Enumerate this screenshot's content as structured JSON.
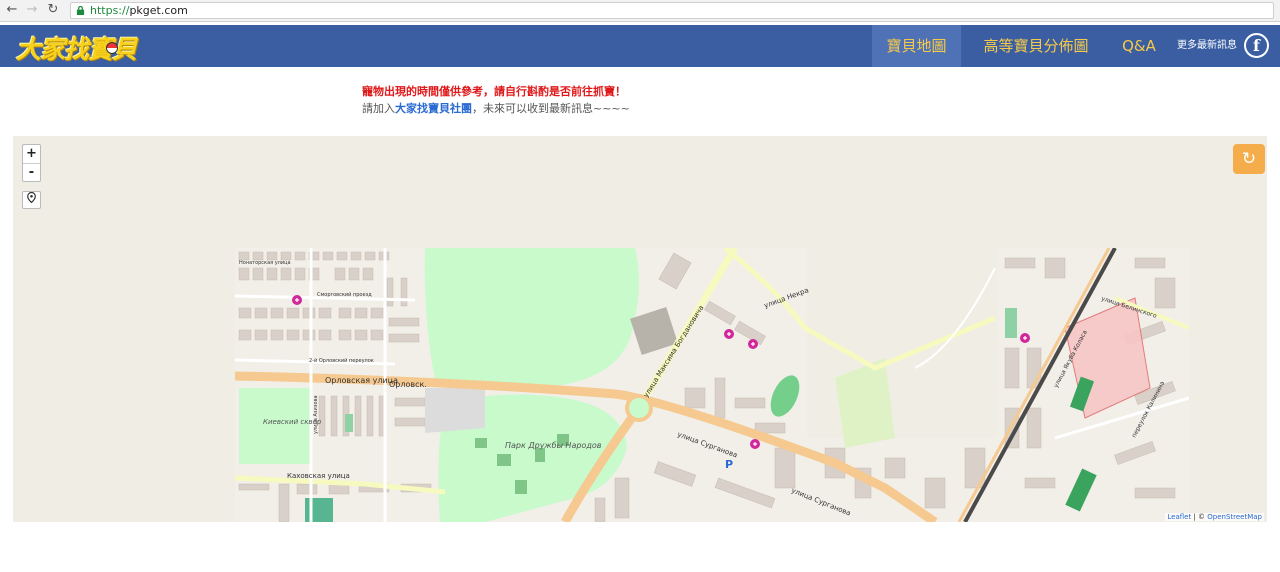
{
  "browser": {
    "url_scheme": "https://",
    "url_domain": "pkget.com",
    "back_icon": "arrow-left-icon",
    "forward_icon": "arrow-right-icon",
    "reload_icon": "reload-icon",
    "lock_icon": "lock-icon"
  },
  "header": {
    "logo_text": "大家找寶貝",
    "nav": {
      "map": "寶貝地圖",
      "distribution": "高等寶貝分佈圖",
      "qa": "Q&A",
      "news": "更多最新訊息"
    },
    "facebook_icon": "facebook-icon",
    "colors": {
      "bar": "#3a5ea1",
      "active": "#4e72b5",
      "nav_text": "#f7c948"
    }
  },
  "notice": {
    "warning": "寵物出現的時間僅供參考，請自行斟酌是否前往抓寶！",
    "join_prefix": "請加入",
    "join_link": "大家找寶貝社團",
    "join_suffix": "，未來可以收到最新訊息~~~~"
  },
  "map": {
    "zoom_in": "+",
    "zoom_out": "-",
    "locate_icon": "map-pin-icon",
    "refresh_icon": "refresh-icon",
    "attribution_leaflet": "Leaflet",
    "attribution_sep": " | © ",
    "attribution_osm": "OpenStreetMap",
    "labels": {
      "street1": "Орловская улица",
      "street2": "Орловск.",
      "street3": "Каховская улица",
      "street4": "улица Максима Богдановича",
      "street5": "улица Некра",
      "street6": "улица Сурганова",
      "street7": "улица Сурганова",
      "street8": "Нонаторская улица",
      "street9": "Сморговский проезд",
      "street10": "2-й Орловский переулок",
      "street11": "улица Белинского",
      "street12": "улица Якуба Коласа",
      "street13": "переулок Калинина",
      "park1": "Парк Дружбы Народов",
      "park2": "Киевский сквер",
      "street14": "улица Азизова",
      "parking": "P"
    }
  }
}
